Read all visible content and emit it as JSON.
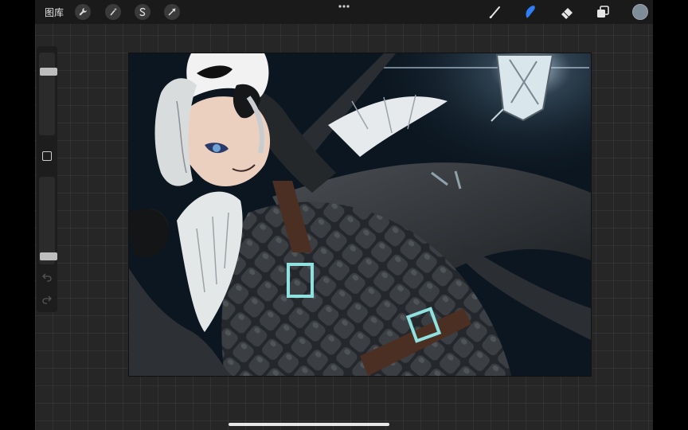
{
  "topbar": {
    "gallery_label": "图库",
    "left_tools": [
      "wrench-icon",
      "magic-wand-icon",
      "selection-s-icon",
      "transform-arrow-icon"
    ],
    "more_icon": "ellipsis-icon",
    "right_tools": [
      "brush-icon",
      "smudge-icon",
      "eraser-icon",
      "layers-icon"
    ],
    "active_tool": "smudge-icon",
    "active_tool_color": "#2f7ef7",
    "current_color": "#7e8d97"
  },
  "sidebar": {
    "brush_size": 0.2,
    "opacity": 0.95,
    "modify_icon": "square-icon",
    "undo_icon": "undo-arrow-icon",
    "redo_icon": "redo-arrow-icon"
  },
  "canvas": {
    "background_color": "#0b1620",
    "content": "artwork-illustration"
  }
}
